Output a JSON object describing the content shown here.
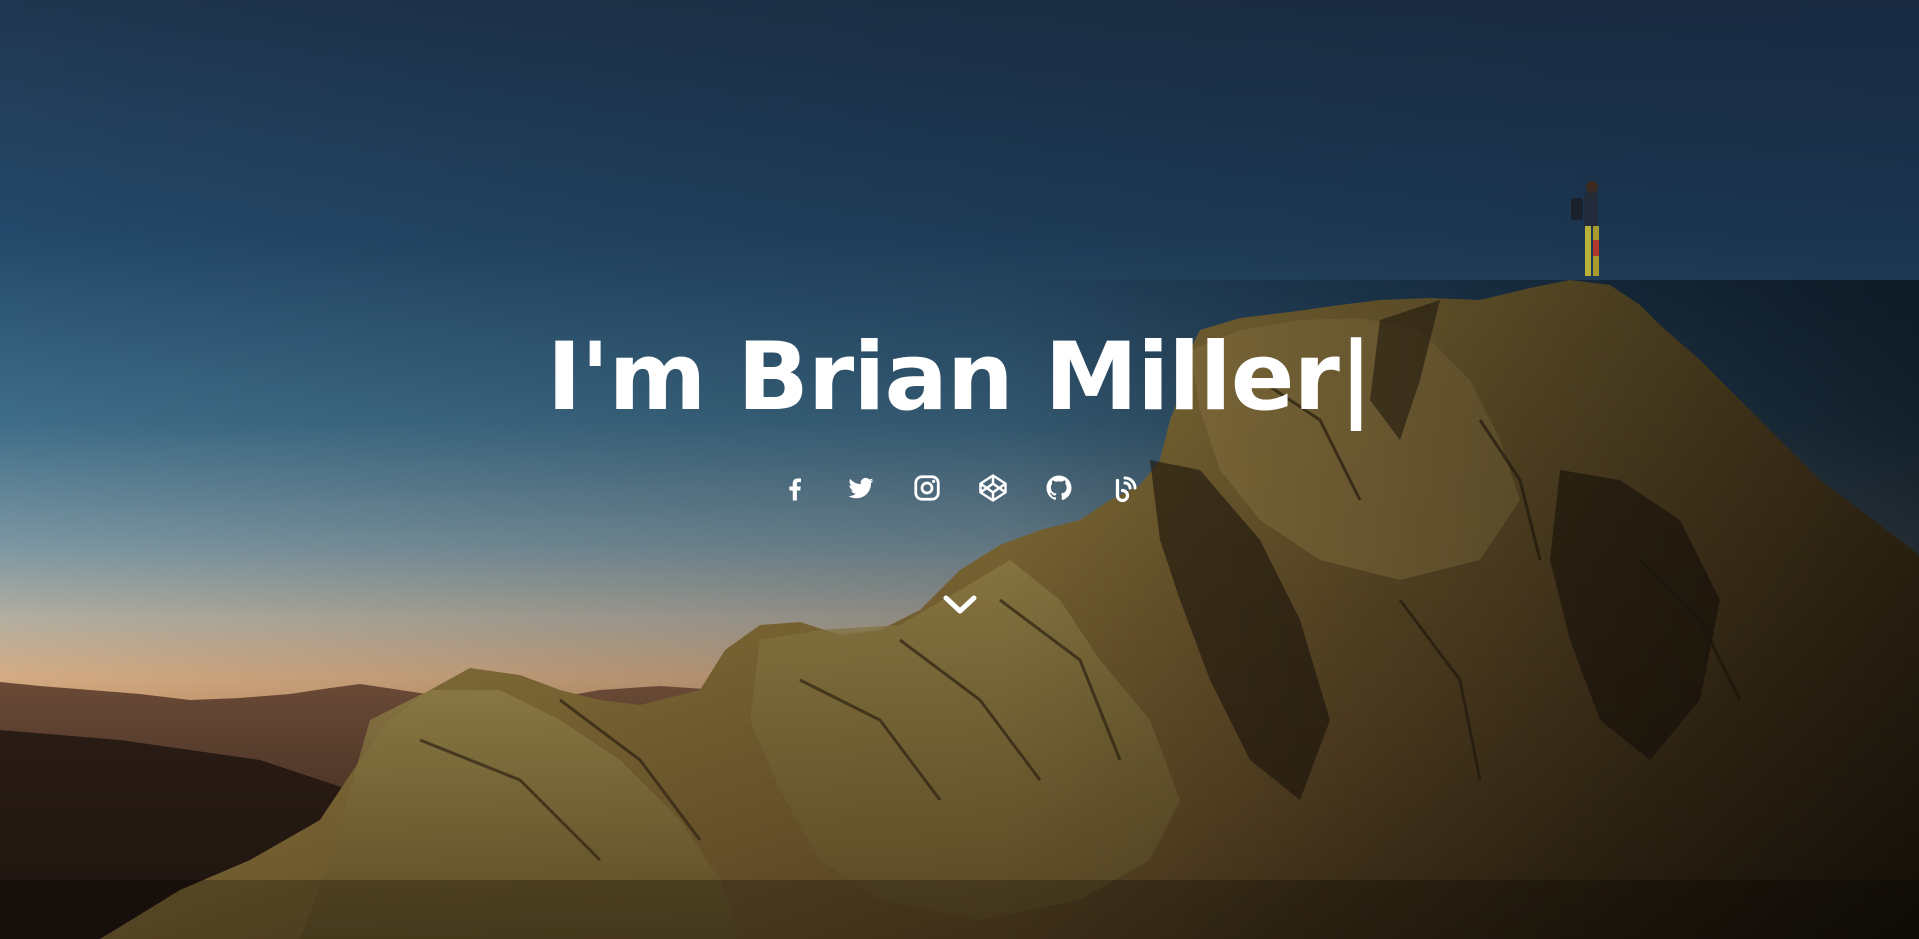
{
  "hero": {
    "name_prefix": "I'm ",
    "name": "Brian Miller",
    "cursor": "|",
    "text_color": "#ffffff",
    "sky_top": "#1f3550",
    "sky_horizon": "#c9a27a"
  },
  "social_links": [
    {
      "icon": "facebook-icon"
    },
    {
      "icon": "twitter-icon"
    },
    {
      "icon": "instagram-icon"
    },
    {
      "icon": "codepen-icon"
    },
    {
      "icon": "github-icon"
    },
    {
      "icon": "blogger-rss-icon"
    }
  ],
  "scroll_indicator": {
    "icon": "chevron-down-icon"
  }
}
